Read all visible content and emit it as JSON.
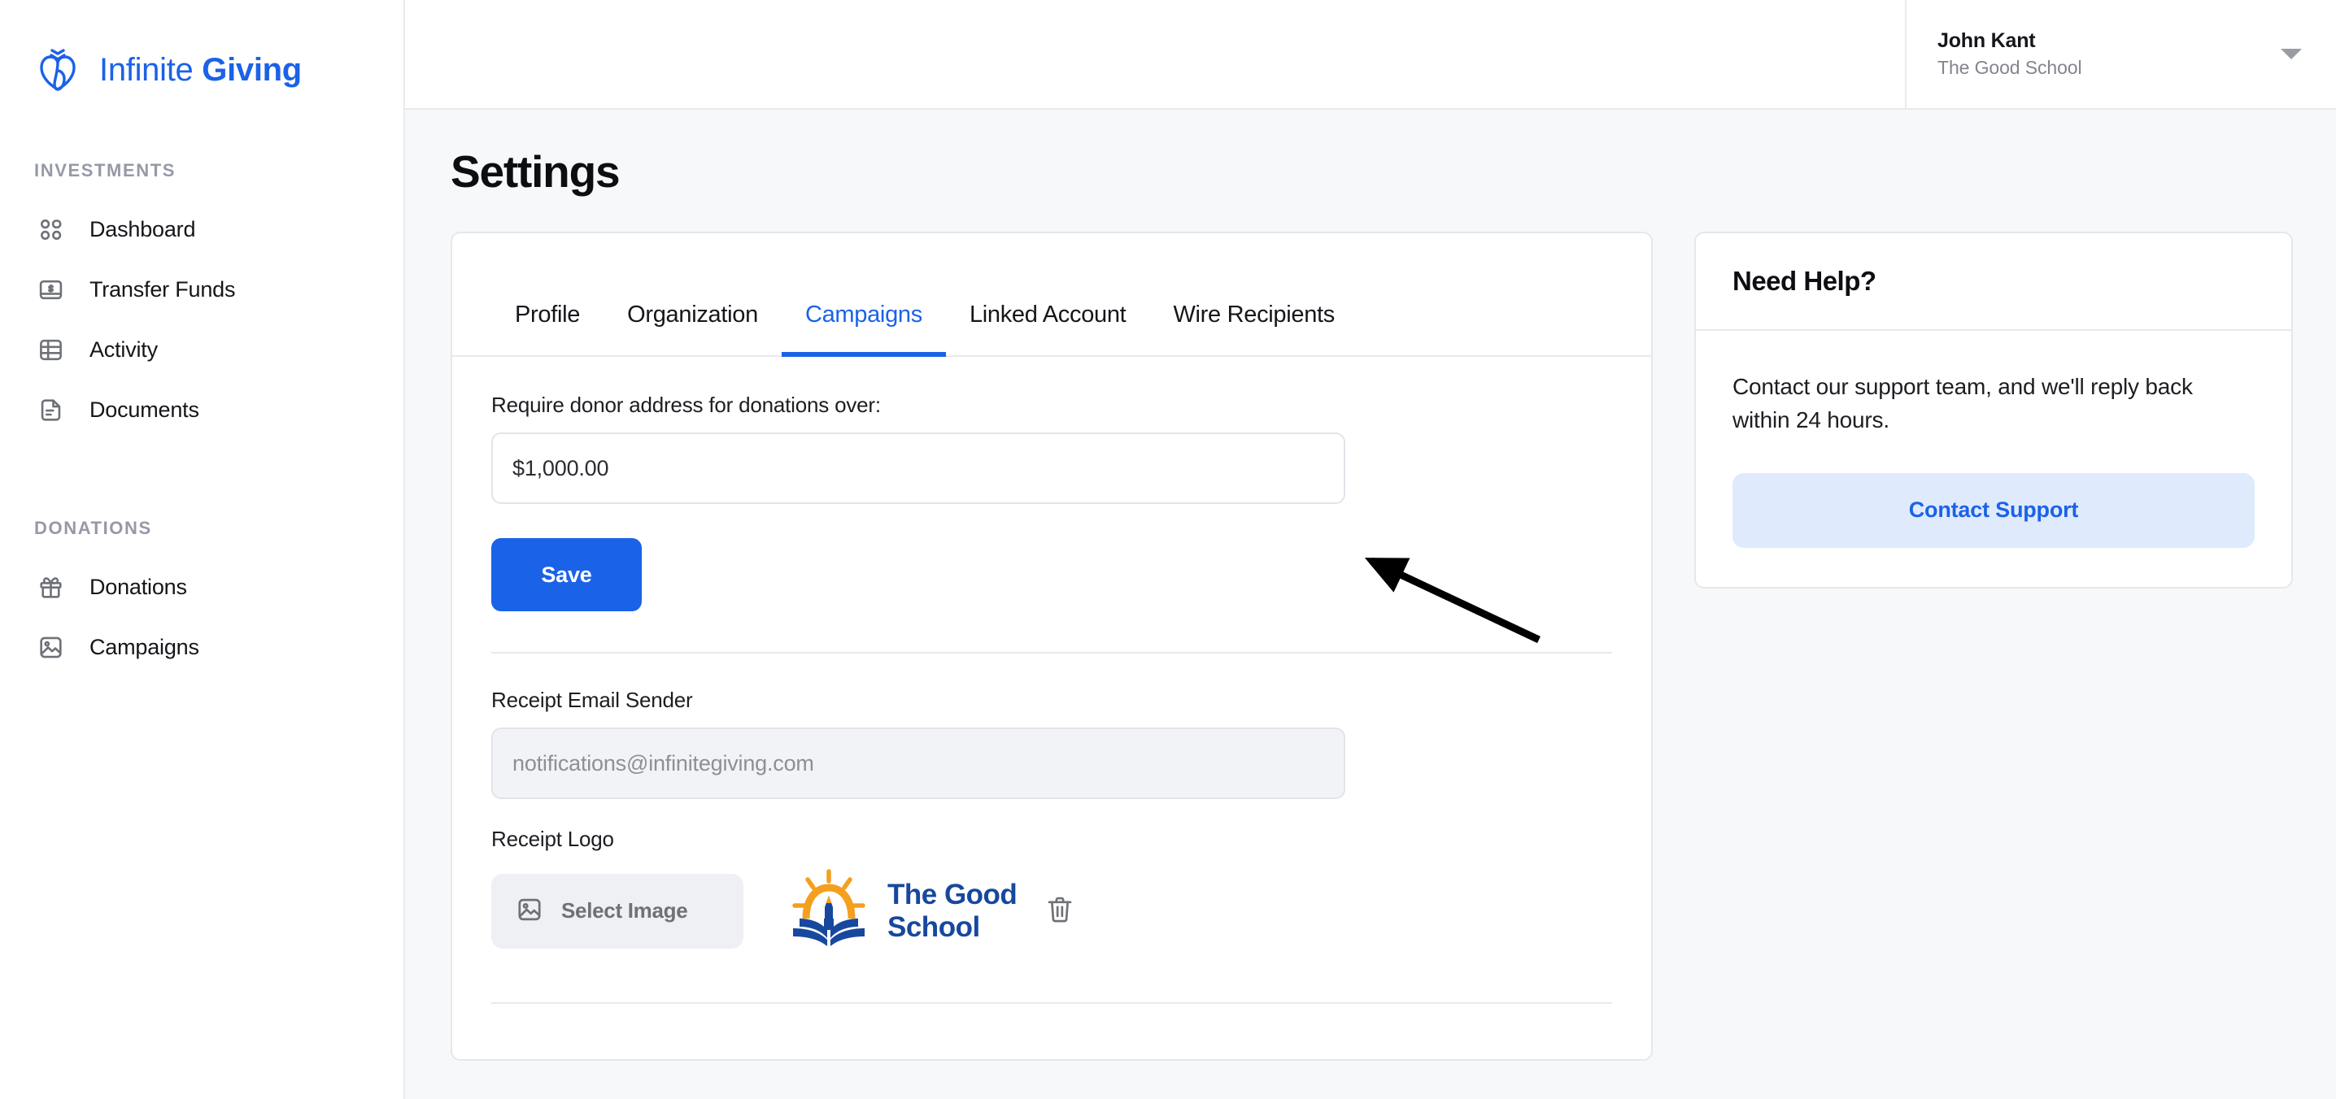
{
  "brand": {
    "name_light": "Infinite",
    "name_bold": "Giving",
    "logo_icon": "infinite-giving-logo-icon",
    "color": "#1a62e8"
  },
  "sidebar": {
    "groups": [
      {
        "label": "INVESTMENTS",
        "items": [
          {
            "label": "Dashboard",
            "icon": "dashboard-icon"
          },
          {
            "label": "Transfer Funds",
            "icon": "money-card-icon"
          },
          {
            "label": "Activity",
            "icon": "table-grid-icon"
          },
          {
            "label": "Documents",
            "icon": "document-icon"
          }
        ]
      },
      {
        "label": "DONATIONS",
        "items": [
          {
            "label": "Donations",
            "icon": "gift-icon"
          },
          {
            "label": "Campaigns",
            "icon": "image-icon"
          }
        ]
      }
    ]
  },
  "topbar": {
    "user_name": "John Kant",
    "user_org": "The Good School",
    "caret_icon": "chevron-down-icon"
  },
  "page": {
    "title": "Settings"
  },
  "tabs": [
    {
      "label": "Profile",
      "active": false
    },
    {
      "label": "Organization",
      "active": false
    },
    {
      "label": "Campaigns",
      "active": true
    },
    {
      "label": "Linked Account",
      "active": false
    },
    {
      "label": "Wire Recipients",
      "active": false
    }
  ],
  "campaigns_form": {
    "donor_address_label": "Require donor address for donations over:",
    "donor_address_value": "$1,000.00",
    "save_label": "Save",
    "receipt_email_label": "Receipt Email Sender",
    "receipt_email_value": "notifications@infinitegiving.com",
    "receipt_logo_label": "Receipt Logo",
    "select_image_label": "Select Image",
    "select_image_icon": "image-icon",
    "delete_icon": "trash-icon",
    "logo_name_line1": "The Good",
    "logo_name_line2": "School",
    "logo_icon": "the-good-school-logo-icon"
  },
  "help_card": {
    "title": "Need Help?",
    "body": "Contact our support team, and we'll reply back within 24 hours.",
    "button_label": "Contact Support",
    "button_bg": "#dfeafd",
    "button_color": "#1a62e8"
  },
  "annotation": {
    "type": "arrow",
    "description": "black arrow pointing at donor address input"
  }
}
